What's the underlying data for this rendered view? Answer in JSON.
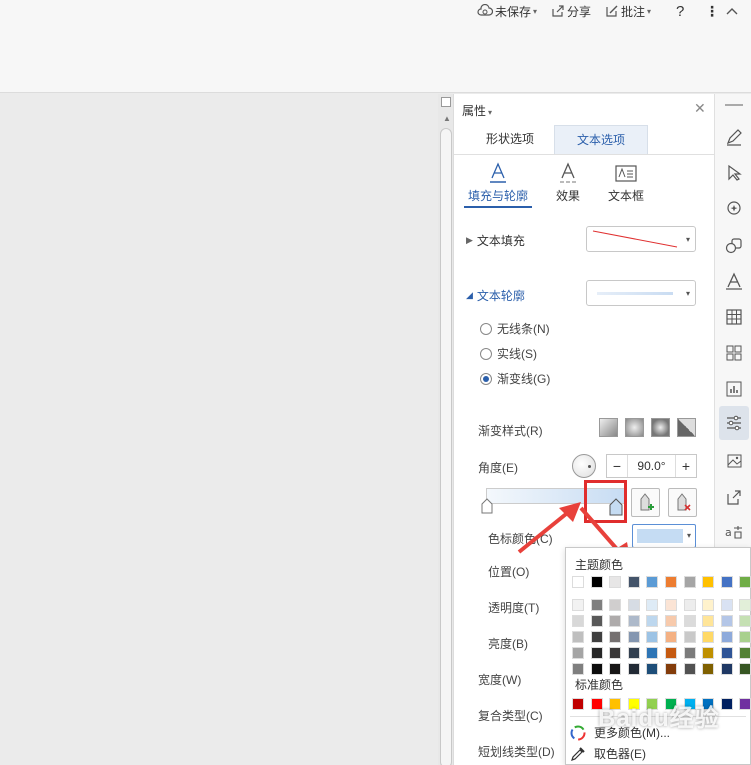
{
  "topbar": {
    "unsaved_label": "未保存",
    "share_label": "分享",
    "comment_label": "批注"
  },
  "panel": {
    "title": "属性",
    "tabs": [
      "形状选项",
      "文本选项"
    ],
    "subtabs": [
      "填充与轮廓",
      "效果",
      "文本框"
    ],
    "text_fill_label": "文本填充",
    "text_outline_label": "文本轮廓",
    "outline_options": [
      "无线条(N)",
      "实线(S)",
      "渐变线(G)"
    ],
    "selected_outline": "渐变线(G)",
    "gradient_style_label": "渐变样式(R)",
    "angle_label": "角度(E)",
    "angle_value": "90.0°",
    "stop_color_label": "色标颜色(C)",
    "position_label": "位置(O)",
    "transparency_label": "透明度(T)",
    "brightness_label": "亮度(B)",
    "width_label": "宽度(W)",
    "compound_type_label": "复合类型(C)",
    "dash_type_label": "短划线类型(D)"
  },
  "color_popup": {
    "theme_title": "主题颜色",
    "standard_title": "标准颜色",
    "more_colors": "更多颜色(M)...",
    "eyedropper": "取色器(E)",
    "theme_top_row": [
      "#ffffff",
      "#000000",
      "#e7e6e6",
      "#44546a",
      "#5b9bd5",
      "#ed7d31",
      "#a5a5a5",
      "#ffc000",
      "#4472c4",
      "#70ad47"
    ],
    "theme_shades": [
      [
        "#f2f2f2",
        "#7f7f7f",
        "#d0cece",
        "#d6dce4",
        "#deebf6",
        "#fbe4d5",
        "#ededed",
        "#fff2cc",
        "#d9e2f3",
        "#e2efd9"
      ],
      [
        "#d8d8d8",
        "#595959",
        "#aeabab",
        "#adb9ca",
        "#bdd7ee",
        "#f7caac",
        "#dbdbdb",
        "#ffe599",
        "#b4c6e7",
        "#c5e0b3"
      ],
      [
        "#bfbfbf",
        "#3f3f3f",
        "#757070",
        "#8496b0",
        "#9cc3e5",
        "#f4b183",
        "#c9c9c9",
        "#ffd966",
        "#8eaadb",
        "#a8d08d"
      ],
      [
        "#a5a5a5",
        "#262626",
        "#3a3838",
        "#323f4f",
        "#2e75b5",
        "#c55a11",
        "#7b7b7b",
        "#bf9000",
        "#2f5496",
        "#538135"
      ],
      [
        "#7f7f7f",
        "#0c0c0c",
        "#171616",
        "#222a35",
        "#1e4e79",
        "#833c0b",
        "#525252",
        "#7f6000",
        "#1f3864",
        "#375623"
      ]
    ],
    "standard_colors": [
      "#c00000",
      "#ff0000",
      "#ffc000",
      "#ffff00",
      "#92d050",
      "#00b050",
      "#00b0f0",
      "#0070c0",
      "#002060",
      "#7030a0"
    ]
  },
  "watermark": "Baidu经验",
  "colors": {
    "accent": "#2b5fab",
    "annotation_red": "#e02d2d",
    "stop_color": "#c5dcf3"
  }
}
